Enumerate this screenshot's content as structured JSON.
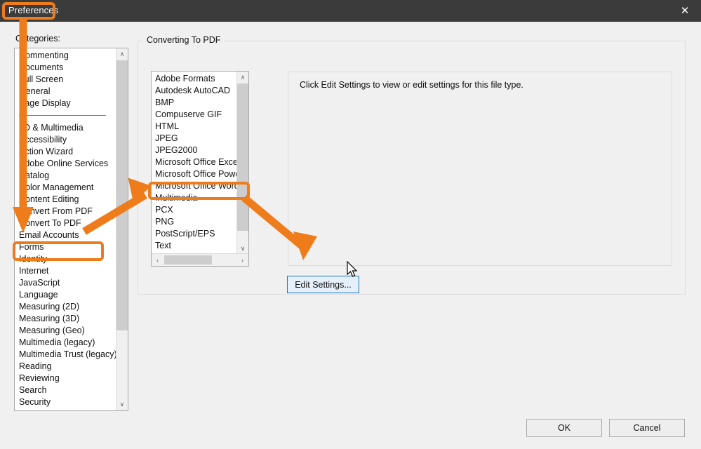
{
  "window": {
    "title": "Preferences",
    "close_icon": "close-icon"
  },
  "labels": {
    "categories": "Categories:",
    "group_title": "Converting To PDF",
    "info_text": "Click Edit Settings to view or edit settings for this file type."
  },
  "categories": {
    "top_group": [
      "Commenting",
      "Documents",
      "Full Screen",
      "General",
      "Page Display"
    ],
    "main_group": [
      "3D & Multimedia",
      "Accessibility",
      "Action Wizard",
      "Adobe Online Services",
      "Catalog",
      "Color Management",
      "Content Editing",
      "Convert From PDF",
      "Convert To PDF",
      "Email Accounts",
      "Forms",
      "Identity",
      "Internet",
      "JavaScript",
      "Language",
      "Measuring (2D)",
      "Measuring (3D)",
      "Measuring (Geo)",
      "Multimedia (legacy)",
      "Multimedia Trust (legacy)",
      "Reading",
      "Reviewing",
      "Search",
      "Security"
    ],
    "selected": "Convert To PDF"
  },
  "formats": {
    "items": [
      "Adobe Formats",
      "Autodesk AutoCAD",
      "BMP",
      "Compuserve GIF",
      "HTML",
      "JPEG",
      "JPEG2000",
      "Microsoft Office Excel",
      "Microsoft Office Power",
      "Microsoft Office Word",
      "Multimedia",
      "PCX",
      "PNG",
      "PostScript/EPS",
      "Text"
    ],
    "selected": "Microsoft Office Word"
  },
  "buttons": {
    "edit_settings": "Edit Settings...",
    "ok": "OK",
    "cancel": "Cancel"
  },
  "scrollbars": {
    "up_arrow_icon": "chevron-up-icon",
    "down_arrow_icon": "chevron-down-icon",
    "left_arrow_icon": "chevron-left-icon",
    "right_arrow_icon": "chevron-right-icon",
    "up_glyph": "∧",
    "down_glyph": "∨",
    "left_glyph": "‹",
    "right_glyph": "›"
  },
  "annotations": {
    "accent_color": "#ef7c1b",
    "highlight_title": "Preferences",
    "highlight_category": "Convert To PDF",
    "highlight_format": "Microsoft Office Word",
    "arrow_1": "title-to-convert-to-pdf",
    "arrow_2": "convert-to-pdf-to-office-word",
    "arrow_3": "office-word-to-edit-settings"
  },
  "colors": {
    "titlebar": "#3b3b3b",
    "dialog_bg": "#f0f0f0",
    "list_bg": "#ffffff",
    "focus_border": "#1675c8",
    "separator": "#4a7ebb"
  }
}
